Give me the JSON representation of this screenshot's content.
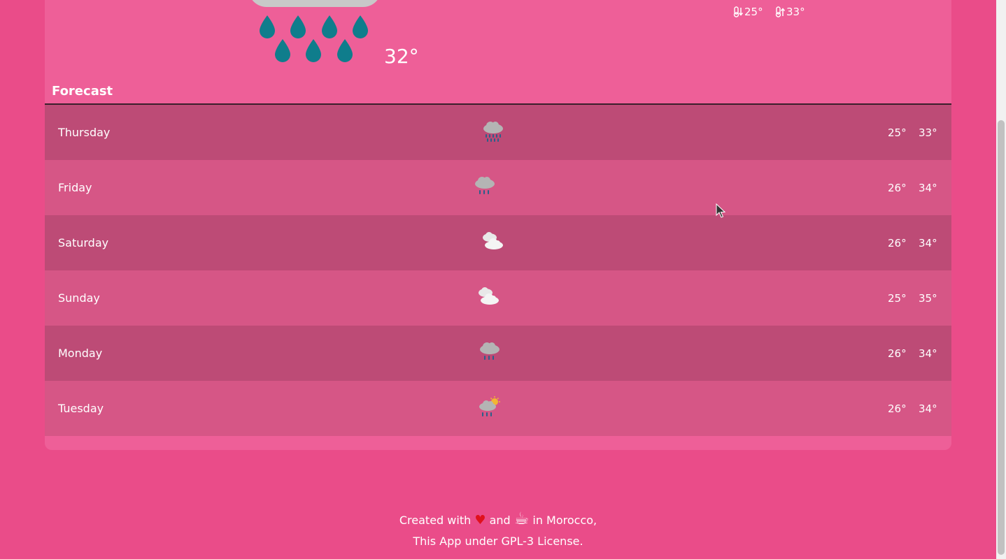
{
  "current": {
    "temp": "32°",
    "min": "25°",
    "max": "33°",
    "condition_icon": "heavy-rain-icon",
    "drop_color": "#0f7d8c"
  },
  "forecast": {
    "title": "Forecast",
    "days": [
      {
        "name": "Thursday",
        "low": "25°",
        "high": "33°",
        "icon": "heavy-rain-icon"
      },
      {
        "name": "Friday",
        "low": "26°",
        "high": "34°",
        "icon": "rain-icon"
      },
      {
        "name": "Saturday",
        "low": "26°",
        "high": "34°",
        "icon": "clouds-icon"
      },
      {
        "name": "Sunday",
        "low": "25°",
        "high": "35°",
        "icon": "clouds-icon"
      },
      {
        "name": "Monday",
        "low": "26°",
        "high": "34°",
        "icon": "rain-icon"
      },
      {
        "name": "Tuesday",
        "low": "26°",
        "high": "34°",
        "icon": "sun-rain-icon"
      }
    ]
  },
  "footer": {
    "created_prefix": "Created with",
    "heart": "♥",
    "and": "and",
    "coffee": "☕",
    "location": "in Morocco,",
    "license": "This App under GPL-3 License."
  },
  "colors": {
    "background": "#ea4c89",
    "card": "#ee5f98",
    "row_dark": "#bd4b76",
    "row_light": "#d65686"
  }
}
